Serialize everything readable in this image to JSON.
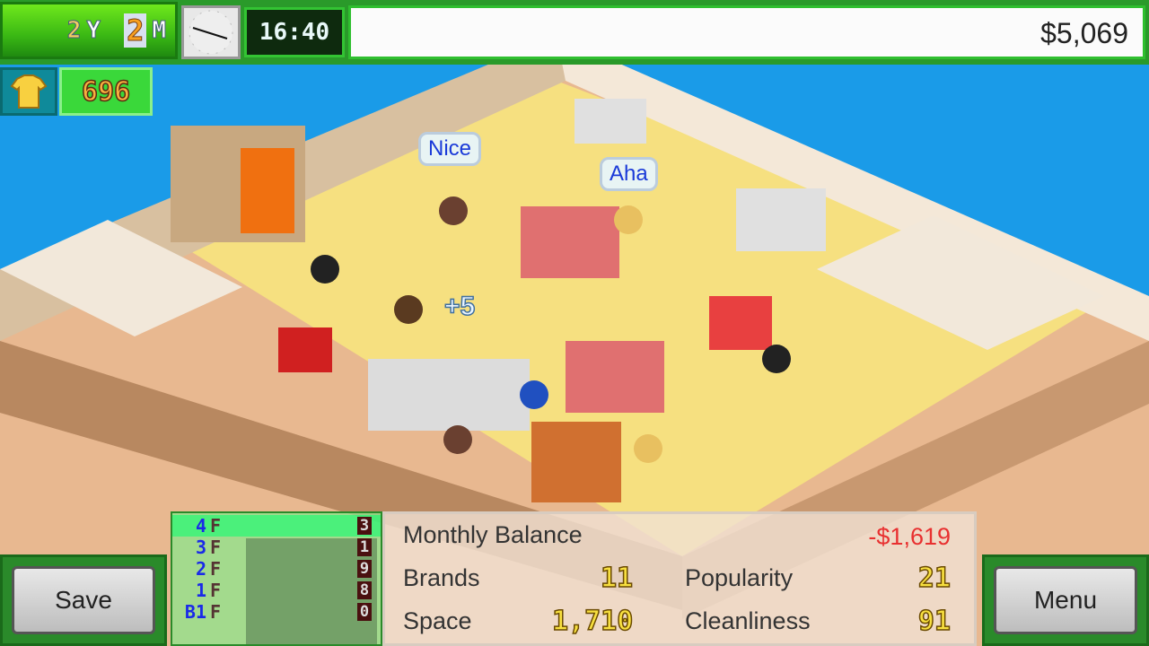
{
  "header": {
    "year": "2",
    "year_unit": "Y",
    "month": "2",
    "month_unit": "M",
    "time": "16:40",
    "funds": "$5,069"
  },
  "resources": {
    "shirt_icon": "shirt-icon",
    "count": "696"
  },
  "scene": {
    "bubbles": [
      "Nice",
      "Aha"
    ],
    "bonus": "+5"
  },
  "floors": [
    {
      "label": "4",
      "suffix": "F",
      "count": "3"
    },
    {
      "label": "3",
      "suffix": "F",
      "count": "1"
    },
    {
      "label": "2",
      "suffix": "F",
      "count": "9"
    },
    {
      "label": "1",
      "suffix": "F",
      "count": "8"
    },
    {
      "label": "B1",
      "suffix": "F",
      "count": "0"
    }
  ],
  "stats": {
    "monthly_balance_label": "Monthly Balance",
    "monthly_balance": "-$1,619",
    "brands_label": "Brands",
    "brands": "11",
    "space_label": "Space",
    "space": "1,710",
    "popularity_label": "Popularity",
    "popularity": "21",
    "cleanliness_label": "Cleanliness",
    "cleanliness": "91"
  },
  "buttons": {
    "save": "Save",
    "menu": "Menu"
  },
  "colors": {
    "negative": "#e83030",
    "accent": "#2fbf2f"
  }
}
